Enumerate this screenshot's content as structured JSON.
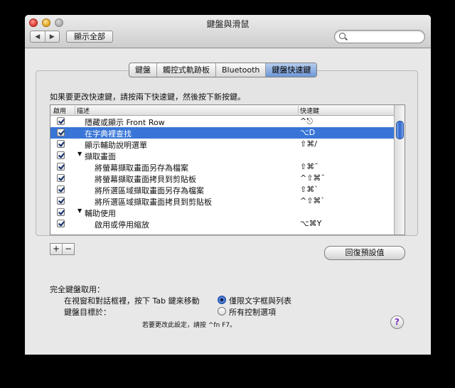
{
  "window": {
    "title": "鍵盤與滑鼠"
  },
  "toolbar": {
    "back": "◀",
    "forward": "▶",
    "show_all": "顯示全部",
    "search_placeholder": ""
  },
  "tabs": [
    {
      "label": "鍵盤",
      "selected": false
    },
    {
      "label": "觸控式軌跡板",
      "selected": false
    },
    {
      "label": "Bluetooth",
      "selected": false
    },
    {
      "label": "鍵盤快速鍵",
      "selected": true
    }
  ],
  "instruction": "如果要更改快速鍵，請按兩下快速鍵，然後按下新按鍵。",
  "table": {
    "headers": {
      "enable": "啟用",
      "description": "描述",
      "shortcut": "快速鍵"
    },
    "rows": [
      {
        "desc": "隱藏或顯示 Front Row",
        "key": "^⎋",
        "checked": true
      },
      {
        "desc": "在字典裡查找",
        "key": "⌥D",
        "checked": true,
        "selected": true
      },
      {
        "desc": "顯示輔助說明選單",
        "key": "⇧⌘/",
        "checked": true
      },
      {
        "desc": "擷取畫面",
        "key": "",
        "checked": true,
        "group": true
      },
      {
        "desc": "將螢幕擷取畫面另存為檔案",
        "key": "⇧⌘˘",
        "checked": true
      },
      {
        "desc": "將螢幕擷取畫面拷貝到剪貼板",
        "key": "^⇧⌘˘",
        "checked": true
      },
      {
        "desc": "將所選區域擷取畫面另存為檔案",
        "key": "⇧⌘`",
        "checked": true
      },
      {
        "desc": "將所選區域擷取畫面拷貝到剪貼板",
        "key": "^⇧⌘`",
        "checked": true
      },
      {
        "desc": "輔助使用",
        "key": "",
        "checked": true,
        "group": true
      },
      {
        "desc": "啟用或停用縮放",
        "key": "⌥⌘Y",
        "checked": true
      }
    ]
  },
  "buttons": {
    "plus": "+",
    "minus": "−",
    "restore_defaults": "回復預設值"
  },
  "full_keyboard": {
    "title": "完全鍵盤取用：",
    "label_line1": "在視窗和對話框裡，按下 Tab 鍵來移動",
    "label_line2": "鍵盤目標於：",
    "option1": "僅限文字框與列表",
    "option2": "所有控制選項",
    "hint": "若要更改此設定，請按 ^fn F7。"
  },
  "help": "?"
}
